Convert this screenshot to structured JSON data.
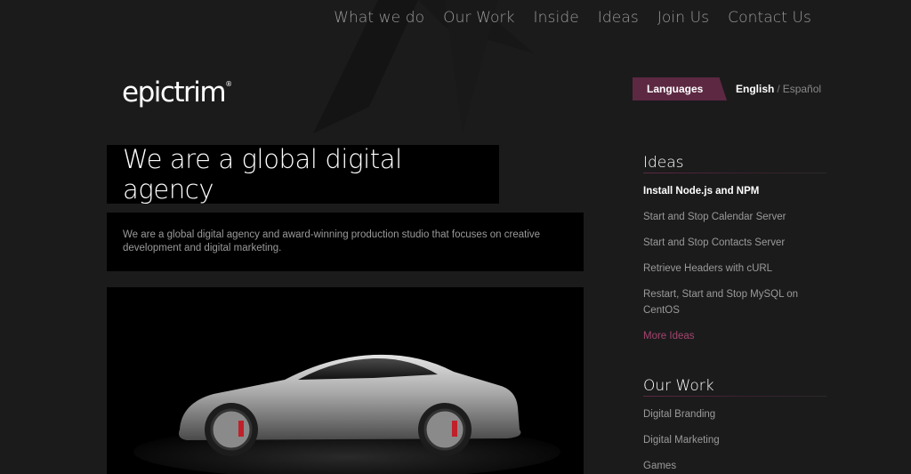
{
  "nav": [
    "What we do",
    "Our Work",
    "Inside",
    "Ideas",
    "Join Us",
    "Contact Us"
  ],
  "logo": {
    "text": "epictrim",
    "mark": "®"
  },
  "languages": {
    "label": "Languages",
    "active": "English",
    "separator": "/",
    "other": "Español"
  },
  "hero": {
    "headline": "We are a global digital agency",
    "intro": "We are a global digital agency and award-winning production studio that focuses on creative development and digital marketing."
  },
  "ideas": {
    "title": "Ideas",
    "items": [
      "Install Node.js and NPM",
      "Start and Stop Calendar Server",
      "Start and Stop Contacts Server",
      "Retrieve Headers with cURL",
      "Restart, Start and Stop MySQL on CentOS"
    ],
    "more": "More Ideas"
  },
  "work": {
    "title": "Our Work",
    "items": [
      "Digital Branding",
      "Digital Marketing",
      "Games"
    ]
  },
  "colors": {
    "accent": "#5c2842",
    "link": "#a2456d",
    "background": "#1b1b1c"
  }
}
